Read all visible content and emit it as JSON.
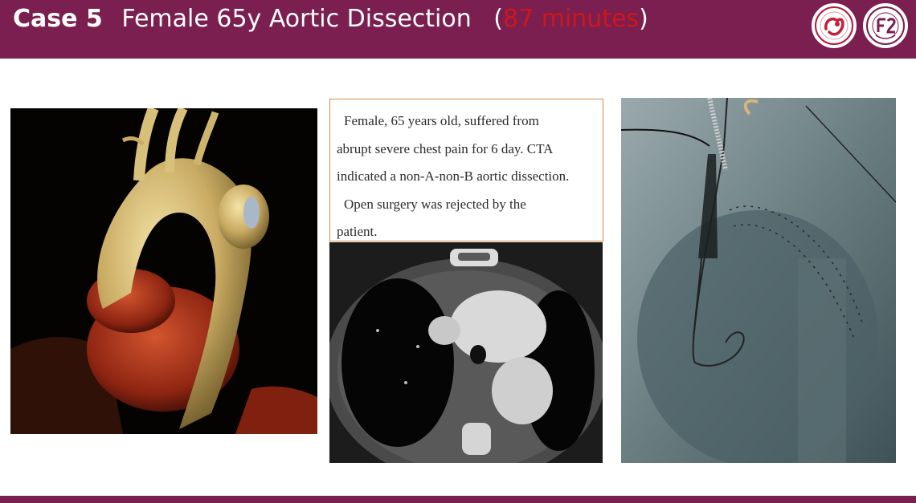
{
  "header": {
    "case_label": "Case 5",
    "title_text": "Female 65y Aortic Dissection",
    "paren_open": "(",
    "duration": "87 minutes",
    "paren_close": ")"
  },
  "case_description": {
    "line1": "Female, 65 years old, suffered from",
    "line2": "abrupt severe chest pain for 6 day. CTA",
    "line3": "indicated a non-A-non-B aortic dissection.",
    "line4": "Open surgery was rejected by the",
    "line5": "patient."
  },
  "colors": {
    "header_bg": "#7a1f4f",
    "highlight": "#d0161a",
    "textbox_border": "#d58a4a"
  }
}
